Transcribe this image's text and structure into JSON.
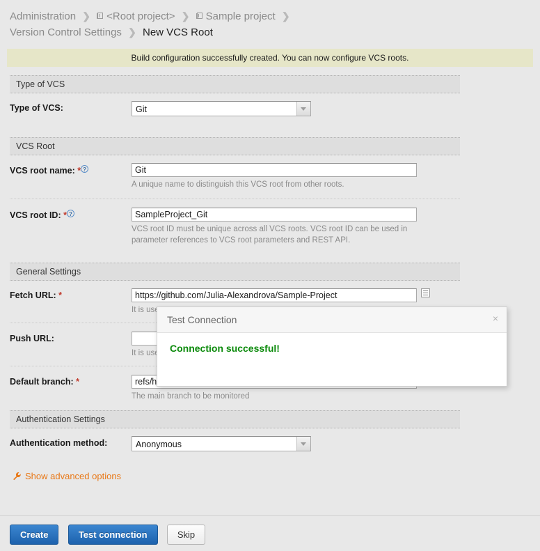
{
  "breadcrumb": {
    "line1": [
      {
        "label": "Administration",
        "icon": null,
        "current": false
      },
      {
        "label": "<Root project>",
        "icon": "project-icon",
        "current": false
      },
      {
        "label": "Sample project",
        "icon": "project-icon",
        "current": false
      }
    ],
    "line2": [
      {
        "label": "Version Control Settings",
        "icon": null,
        "current": false
      },
      {
        "label": "New VCS Root",
        "icon": null,
        "current": true
      }
    ],
    "separator": "❯"
  },
  "notification": {
    "message": "Build configuration successfully created. You can now configure VCS roots.",
    "background": "#e6e6c8"
  },
  "sections": {
    "type_of_vcs": {
      "header": "Type of VCS",
      "field_label": "Type of VCS:",
      "selected": "Git"
    },
    "vcs_root": {
      "header": "VCS Root",
      "name": {
        "label": "VCS root name:",
        "required": "*",
        "help": "?",
        "value": "Git",
        "hint": "A unique name to distinguish this VCS root from other roots."
      },
      "id": {
        "label": "VCS root ID:",
        "required": "*",
        "help": "?",
        "value": "SampleProject_Git",
        "hint": "VCS root ID must be unique across all VCS roots. VCS root ID can be used in parameter references to VCS root parameters and REST API."
      }
    },
    "general_settings": {
      "header": "General Settings",
      "fetch_url": {
        "label": "Fetch URL:",
        "required": "*",
        "value": "https://github.com/Julia-Alexandrova/Sample-Project",
        "hint": "It is use"
      },
      "push_url": {
        "label": "Push URL:",
        "required": "",
        "value": "",
        "hint": "It is use"
      },
      "default_branch": {
        "label": "Default branch:",
        "required": "*",
        "value": "refs/heads/master",
        "hint": "The main branch to be monitored"
      }
    },
    "authentication_settings": {
      "header": "Authentication Settings",
      "method": {
        "label": "Authentication method:",
        "selected": "Anonymous"
      }
    }
  },
  "advanced_link": {
    "label": "Show advanced options",
    "icon": "wrench-icon",
    "color": "#e87817"
  },
  "footer": {
    "create_label": "Create",
    "test_connection_label": "Test connection",
    "skip_label": "Skip"
  },
  "dialog": {
    "title": "Test Connection",
    "close": "×",
    "message": "Connection successful!",
    "message_color": "#0b8a0b"
  }
}
